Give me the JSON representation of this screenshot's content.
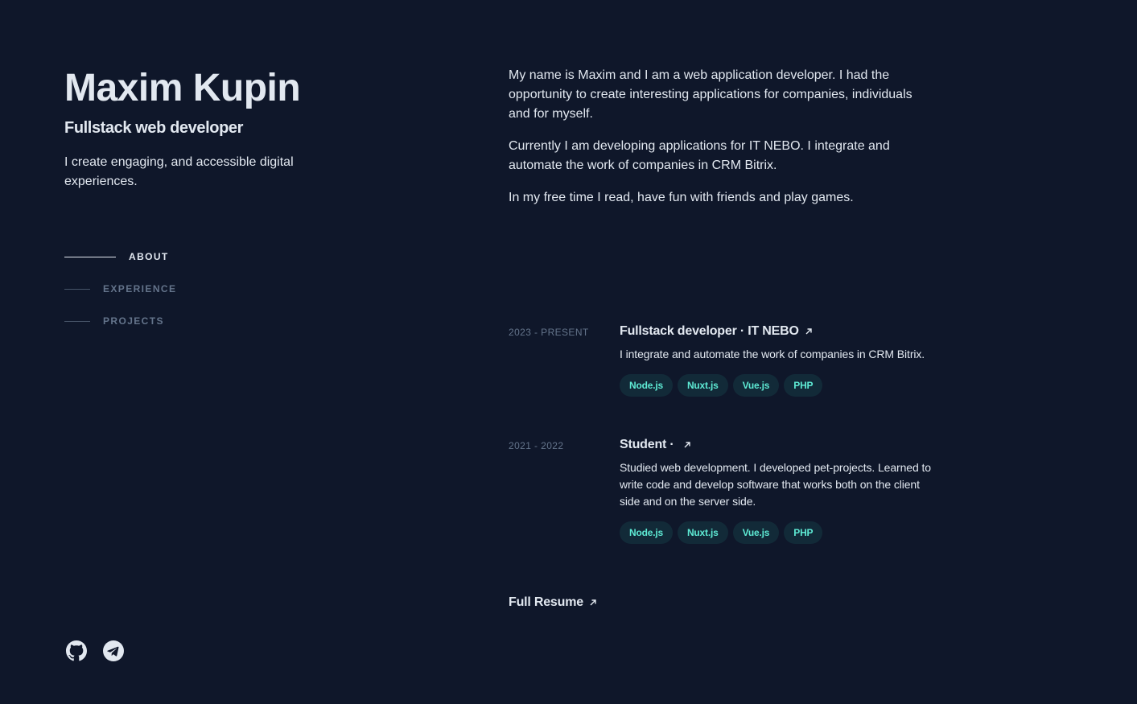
{
  "header": {
    "name": "Maxim Kupin",
    "role": "Fullstack web developer",
    "tagline": "I create engaging, and accessible digital experiences."
  },
  "nav": {
    "items": [
      {
        "label": "ABOUT",
        "active": true
      },
      {
        "label": "EXPERIENCE",
        "active": false
      },
      {
        "label": "PROJECTS",
        "active": false
      }
    ]
  },
  "social": [
    {
      "icon": "github-icon"
    },
    {
      "icon": "telegram-icon"
    }
  ],
  "about": {
    "paragraphs": [
      "My name is Maxim and I am a web application developer. I had the opportunity to create interesting applications for companies, individuals and for myself.",
      "Currently I am developing applications for IT NEBO. I integrate and automate the work of companies in CRM Bitrix.",
      "In my free time I read, have fun with friends and play games."
    ]
  },
  "experience": [
    {
      "date": "2023 - PRESENT",
      "title": "Fullstack developer · IT NEBO",
      "description": "I integrate and automate the work of companies in CRM Bitrix.",
      "tags": [
        "Node.js",
        "Nuxt.js",
        "Vue.js",
        "PHP"
      ]
    },
    {
      "date": "2021 - 2022",
      "title": "Student · ",
      "description": "Studied web development. I developed pet-projects. Learned to write code and develop software that works both on the client side and on the server side.",
      "tags": [
        "Node.js",
        "Nuxt.js",
        "Vue.js",
        "PHP"
      ]
    }
  ],
  "resume": {
    "label": "Full Resume"
  },
  "colors": {
    "background": "#0f172a",
    "text_primary": "#e2e8f0",
    "text_muted": "#64748b",
    "tag_text": "#5eead4"
  }
}
